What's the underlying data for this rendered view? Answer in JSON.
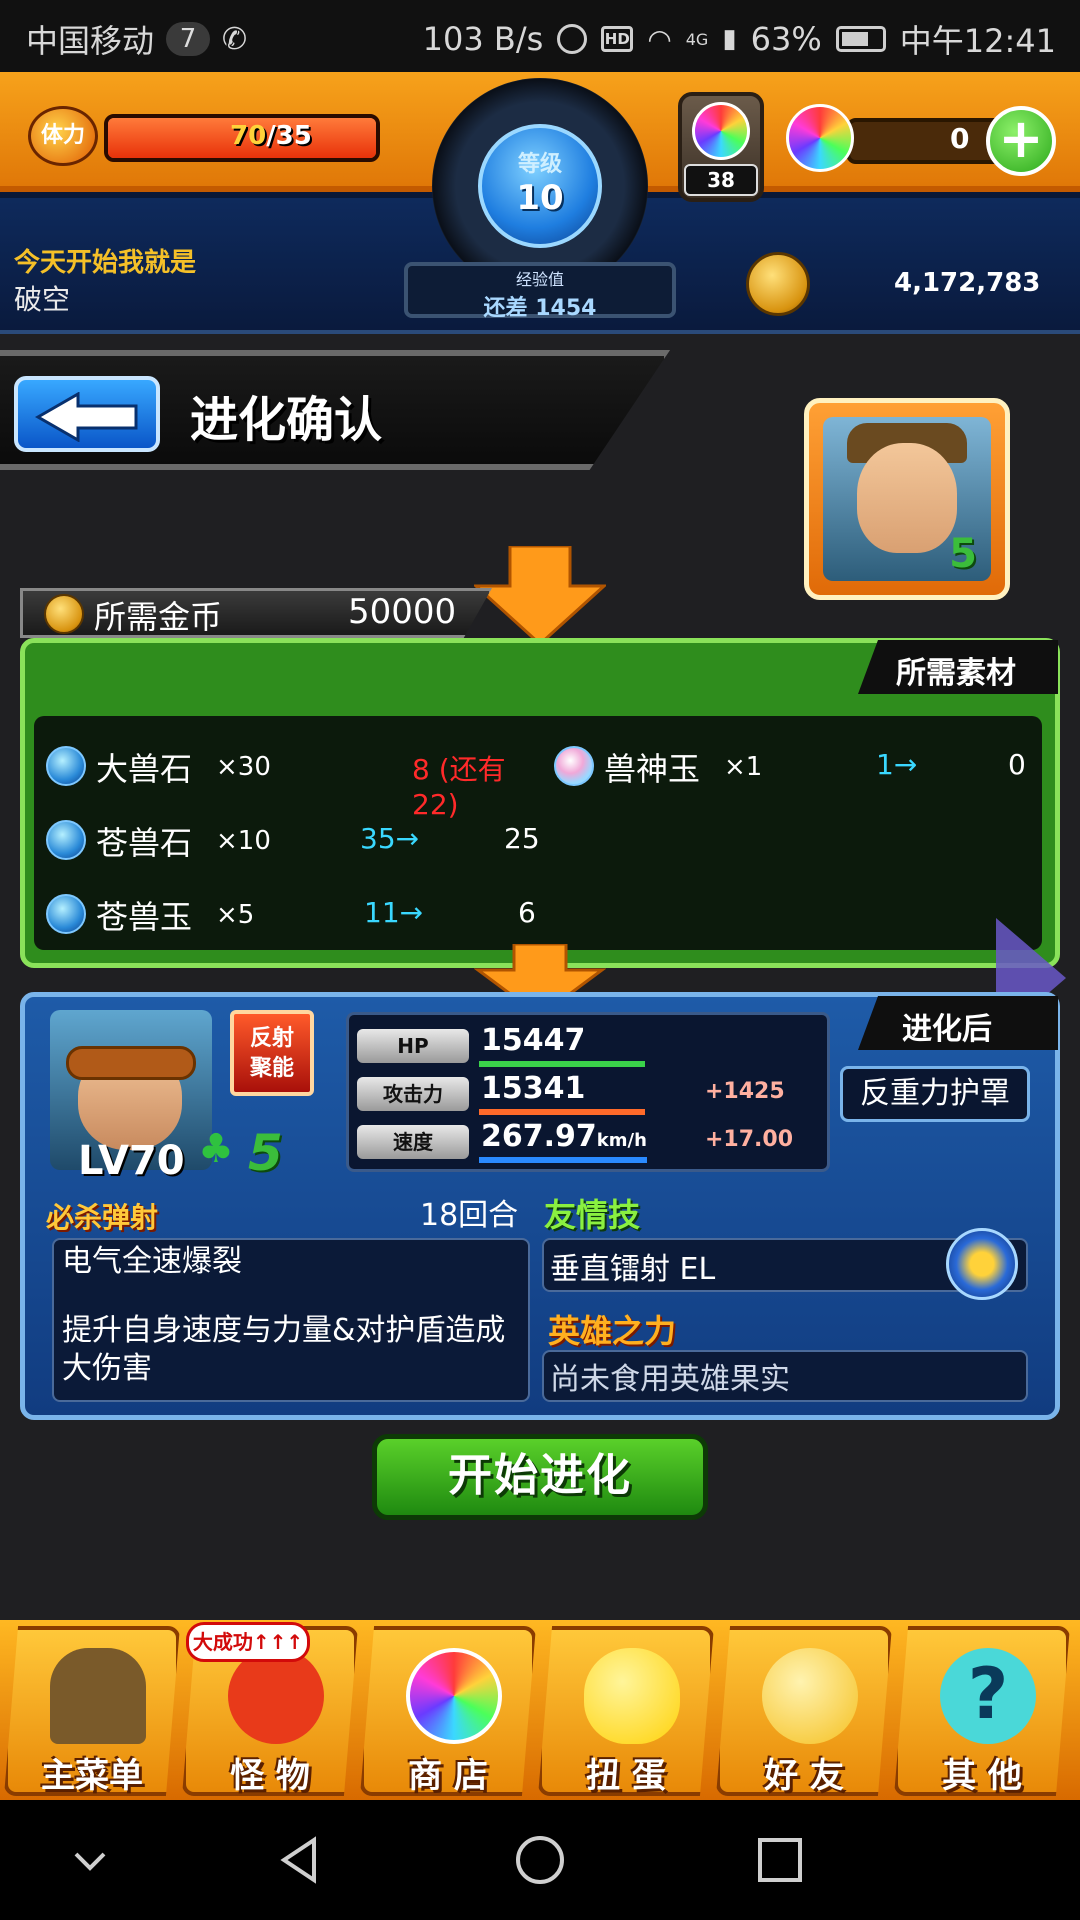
{
  "status_bar": {
    "carrier": "中国移动",
    "badge": "7",
    "speed": "103 B/s",
    "hd": "HD",
    "network": "4G",
    "battery": "63%",
    "time": "中午12:41"
  },
  "header": {
    "stamina_label": "体力",
    "stamina_current": "70",
    "stamina_max": "/35",
    "stamina_fraction": 1.0,
    "level_label": "等级",
    "level": "10",
    "exp_label": "经验值",
    "exp_remaining": "还差 1454",
    "gem_count": "38",
    "orb_count": "0",
    "title_line1": "今天开始我就是",
    "title_line2": "破空",
    "coins": "4,172,783"
  },
  "page": {
    "title": "进化确认"
  },
  "cost": {
    "label": "所需金币",
    "value": "50000"
  },
  "materials": {
    "tag": "所需素材",
    "items": [
      {
        "name": "大兽石",
        "mult": "×30",
        "have": "8 (还有22)",
        "after": ""
      },
      {
        "name": "苍兽石",
        "mult": "×10",
        "have": "35→",
        "after": "25"
      },
      {
        "name": "苍兽玉",
        "mult": "×5",
        "have": "11→",
        "after": "6"
      },
      {
        "name": "兽神玉",
        "mult": "×1",
        "have": "1→",
        "after": "0"
      }
    ]
  },
  "after": {
    "tag": "进化后",
    "level": "LV70",
    "stars": "5",
    "ability_line1": "反射",
    "ability_line2": "聚能",
    "name": "反重力护罩",
    "stats": [
      {
        "label": "HP",
        "value": "15447",
        "unit": "",
        "bonus": "",
        "color": "#3ad24a"
      },
      {
        "label": "攻击力",
        "value": "15341",
        "unit": "",
        "bonus": "+1425",
        "color": "#ff6a2a"
      },
      {
        "label": "速度",
        "value": "267.97",
        "unit": "km/h",
        "bonus": "+17.00",
        "color": "#2a8aff"
      }
    ],
    "skill_title": "必杀弹射",
    "skill_turns": "18回合",
    "skill_name": "电气全速爆裂",
    "skill_desc": "提升自身速度与力量&对护盾造成大伤害",
    "friend_title": "友情技",
    "friend_name": "垂直镭射 EL",
    "hero_title": "英雄之力",
    "hero_text": "尚未食用英雄果实"
  },
  "start_button": "开始进化",
  "nav": {
    "promo": "大成功↑↑↑",
    "items": [
      {
        "label": "主菜单",
        "color": "#7a5a2a"
      },
      {
        "label": "怪 物",
        "color": "#e83a1a"
      },
      {
        "label": "商 店",
        "color": "#6ad8ff"
      },
      {
        "label": "扭 蛋",
        "color": "#ffe040"
      },
      {
        "label": "好 友",
        "color": "#ffe27a"
      },
      {
        "label": "其 他",
        "color": "#4ad8d8"
      }
    ]
  }
}
